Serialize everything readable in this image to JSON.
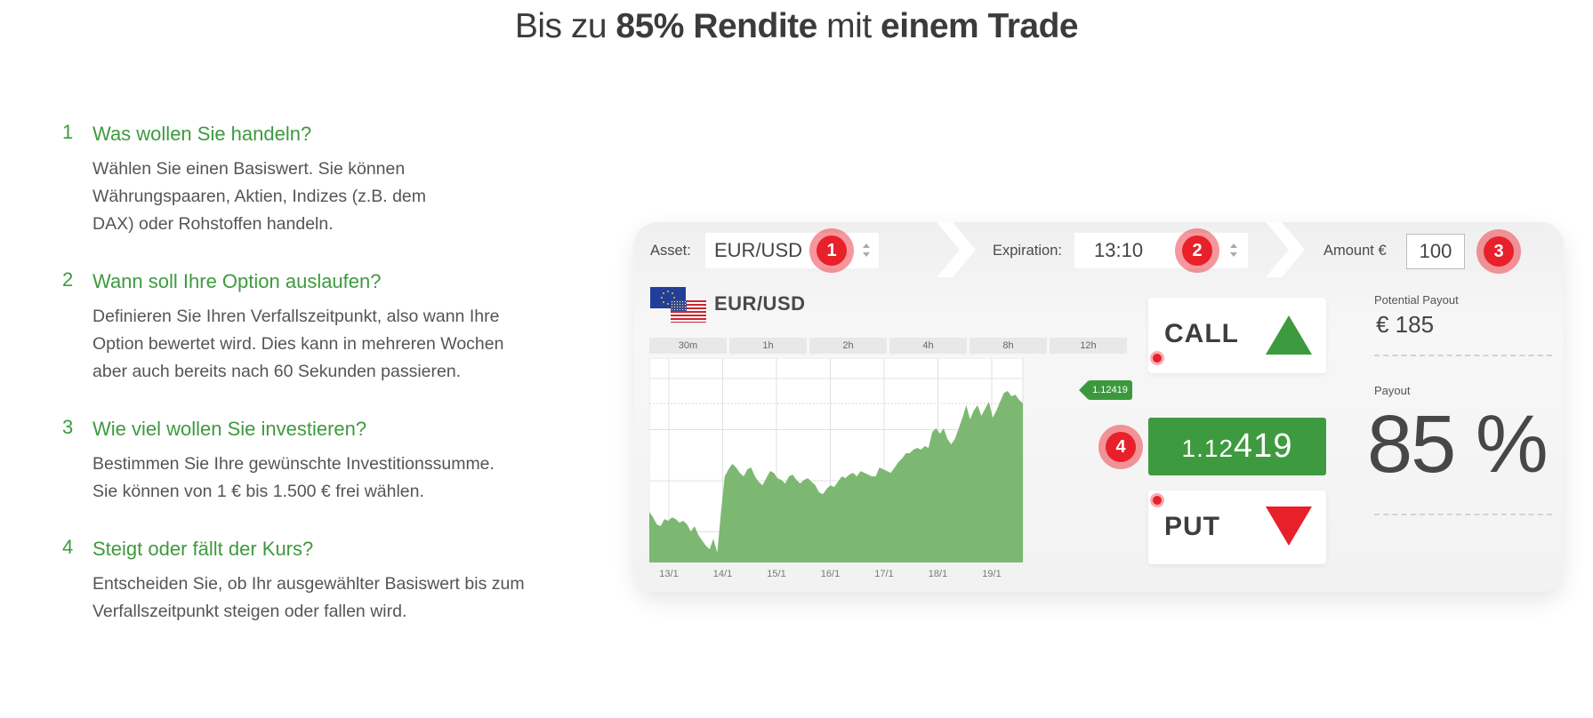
{
  "headline": {
    "prefix": "Bis zu ",
    "bold1": "85% Rendite",
    "middle": " mit ",
    "bold2": "einem Trade"
  },
  "steps": [
    {
      "num": "1",
      "title": "Was wollen Sie handeln?",
      "body": "Wählen Sie einen Basiswert. Sie können Währungspaaren, Aktien, Indizes (z.B. dem DAX) oder Rohstoffen handeln."
    },
    {
      "num": "2",
      "title": "Wann soll Ihre Option auslaufen?",
      "body": "Definieren Sie Ihren Verfallszeitpunkt, also wann Ihre Option bewertet wird. Dies kann in mehreren Wochen aber auch bereits nach 60 Sekunden passieren."
    },
    {
      "num": "3",
      "title": "Wie viel wollen Sie investieren?",
      "body": "Bestimmen Sie Ihre gewünschte Investitionssumme. Sie können von 1 € bis 1.500 € frei wählen."
    },
    {
      "num": "4",
      "title": "Steigt oder fällt der Kurs?",
      "body": "Entscheiden Sie, ob Ihr ausgewählter Basiswert bis zum Verfallszeitpunkt steigen oder fallen wird."
    }
  ],
  "widget": {
    "asset_label": "Asset:",
    "asset_value": "EUR/USD",
    "expiration_label": "Expiration:",
    "expiration_value": "13:10",
    "amount_label": "Amount €",
    "amount_value": "100",
    "badges": [
      "1",
      "2",
      "3",
      "4"
    ],
    "pair_name": "EUR/USD",
    "timeframes": [
      "30m",
      "1h",
      "2h",
      "4h",
      "8h",
      "12h"
    ],
    "current_price": "1.12419",
    "call_label": "CALL",
    "put_label": "PUT",
    "price_small": "1.12",
    "price_big": "419",
    "potential_payout_label": "Potential Payout",
    "potential_payout_value": "€ 185",
    "payout_label": "Payout",
    "payout_value": "85 %",
    "colors": {
      "green": "#3e9a3e",
      "red": "#e8202a",
      "area": "#7cb872"
    }
  },
  "chart_data": {
    "type": "area",
    "title": "EUR/USD",
    "xlabel": "",
    "ylabel": "",
    "x_tick_labels": [
      "13/1",
      "14/1",
      "15/1",
      "16/1",
      "17/1",
      "18/1",
      "19/1"
    ],
    "last_value_label": "1.12419",
    "grid": true,
    "series": [
      {
        "name": "EUR/USD",
        "values": [
          0.25,
          0.22,
          0.18,
          0.17,
          0.21,
          0.2,
          0.22,
          0.21,
          0.19,
          0.2,
          0.18,
          0.14,
          0.17,
          0.12,
          0.09,
          0.06,
          0.04,
          0.1,
          0.02,
          0.25,
          0.45,
          0.49,
          0.52,
          0.5,
          0.47,
          0.45,
          0.49,
          0.5,
          0.45,
          0.42,
          0.4,
          0.44,
          0.48,
          0.47,
          0.44,
          0.43,
          0.41,
          0.45,
          0.46,
          0.43,
          0.41,
          0.43,
          0.44,
          0.42,
          0.4,
          0.36,
          0.35,
          0.38,
          0.4,
          0.39,
          0.42,
          0.45,
          0.44,
          0.46,
          0.47,
          0.45,
          0.48,
          0.47,
          0.46,
          0.45,
          0.45,
          0.5,
          0.49,
          0.48,
          0.47,
          0.5,
          0.53,
          0.55,
          0.58,
          0.58,
          0.6,
          0.61,
          0.6,
          0.62,
          0.61,
          0.7,
          0.72,
          0.69,
          0.72,
          0.66,
          0.63,
          0.66,
          0.72,
          0.78,
          0.85,
          0.77,
          0.82,
          0.85,
          0.79,
          0.83,
          0.87,
          0.78,
          0.82,
          0.87,
          0.92,
          0.93,
          0.9,
          0.91,
          0.88,
          0.86
        ]
      }
    ]
  }
}
